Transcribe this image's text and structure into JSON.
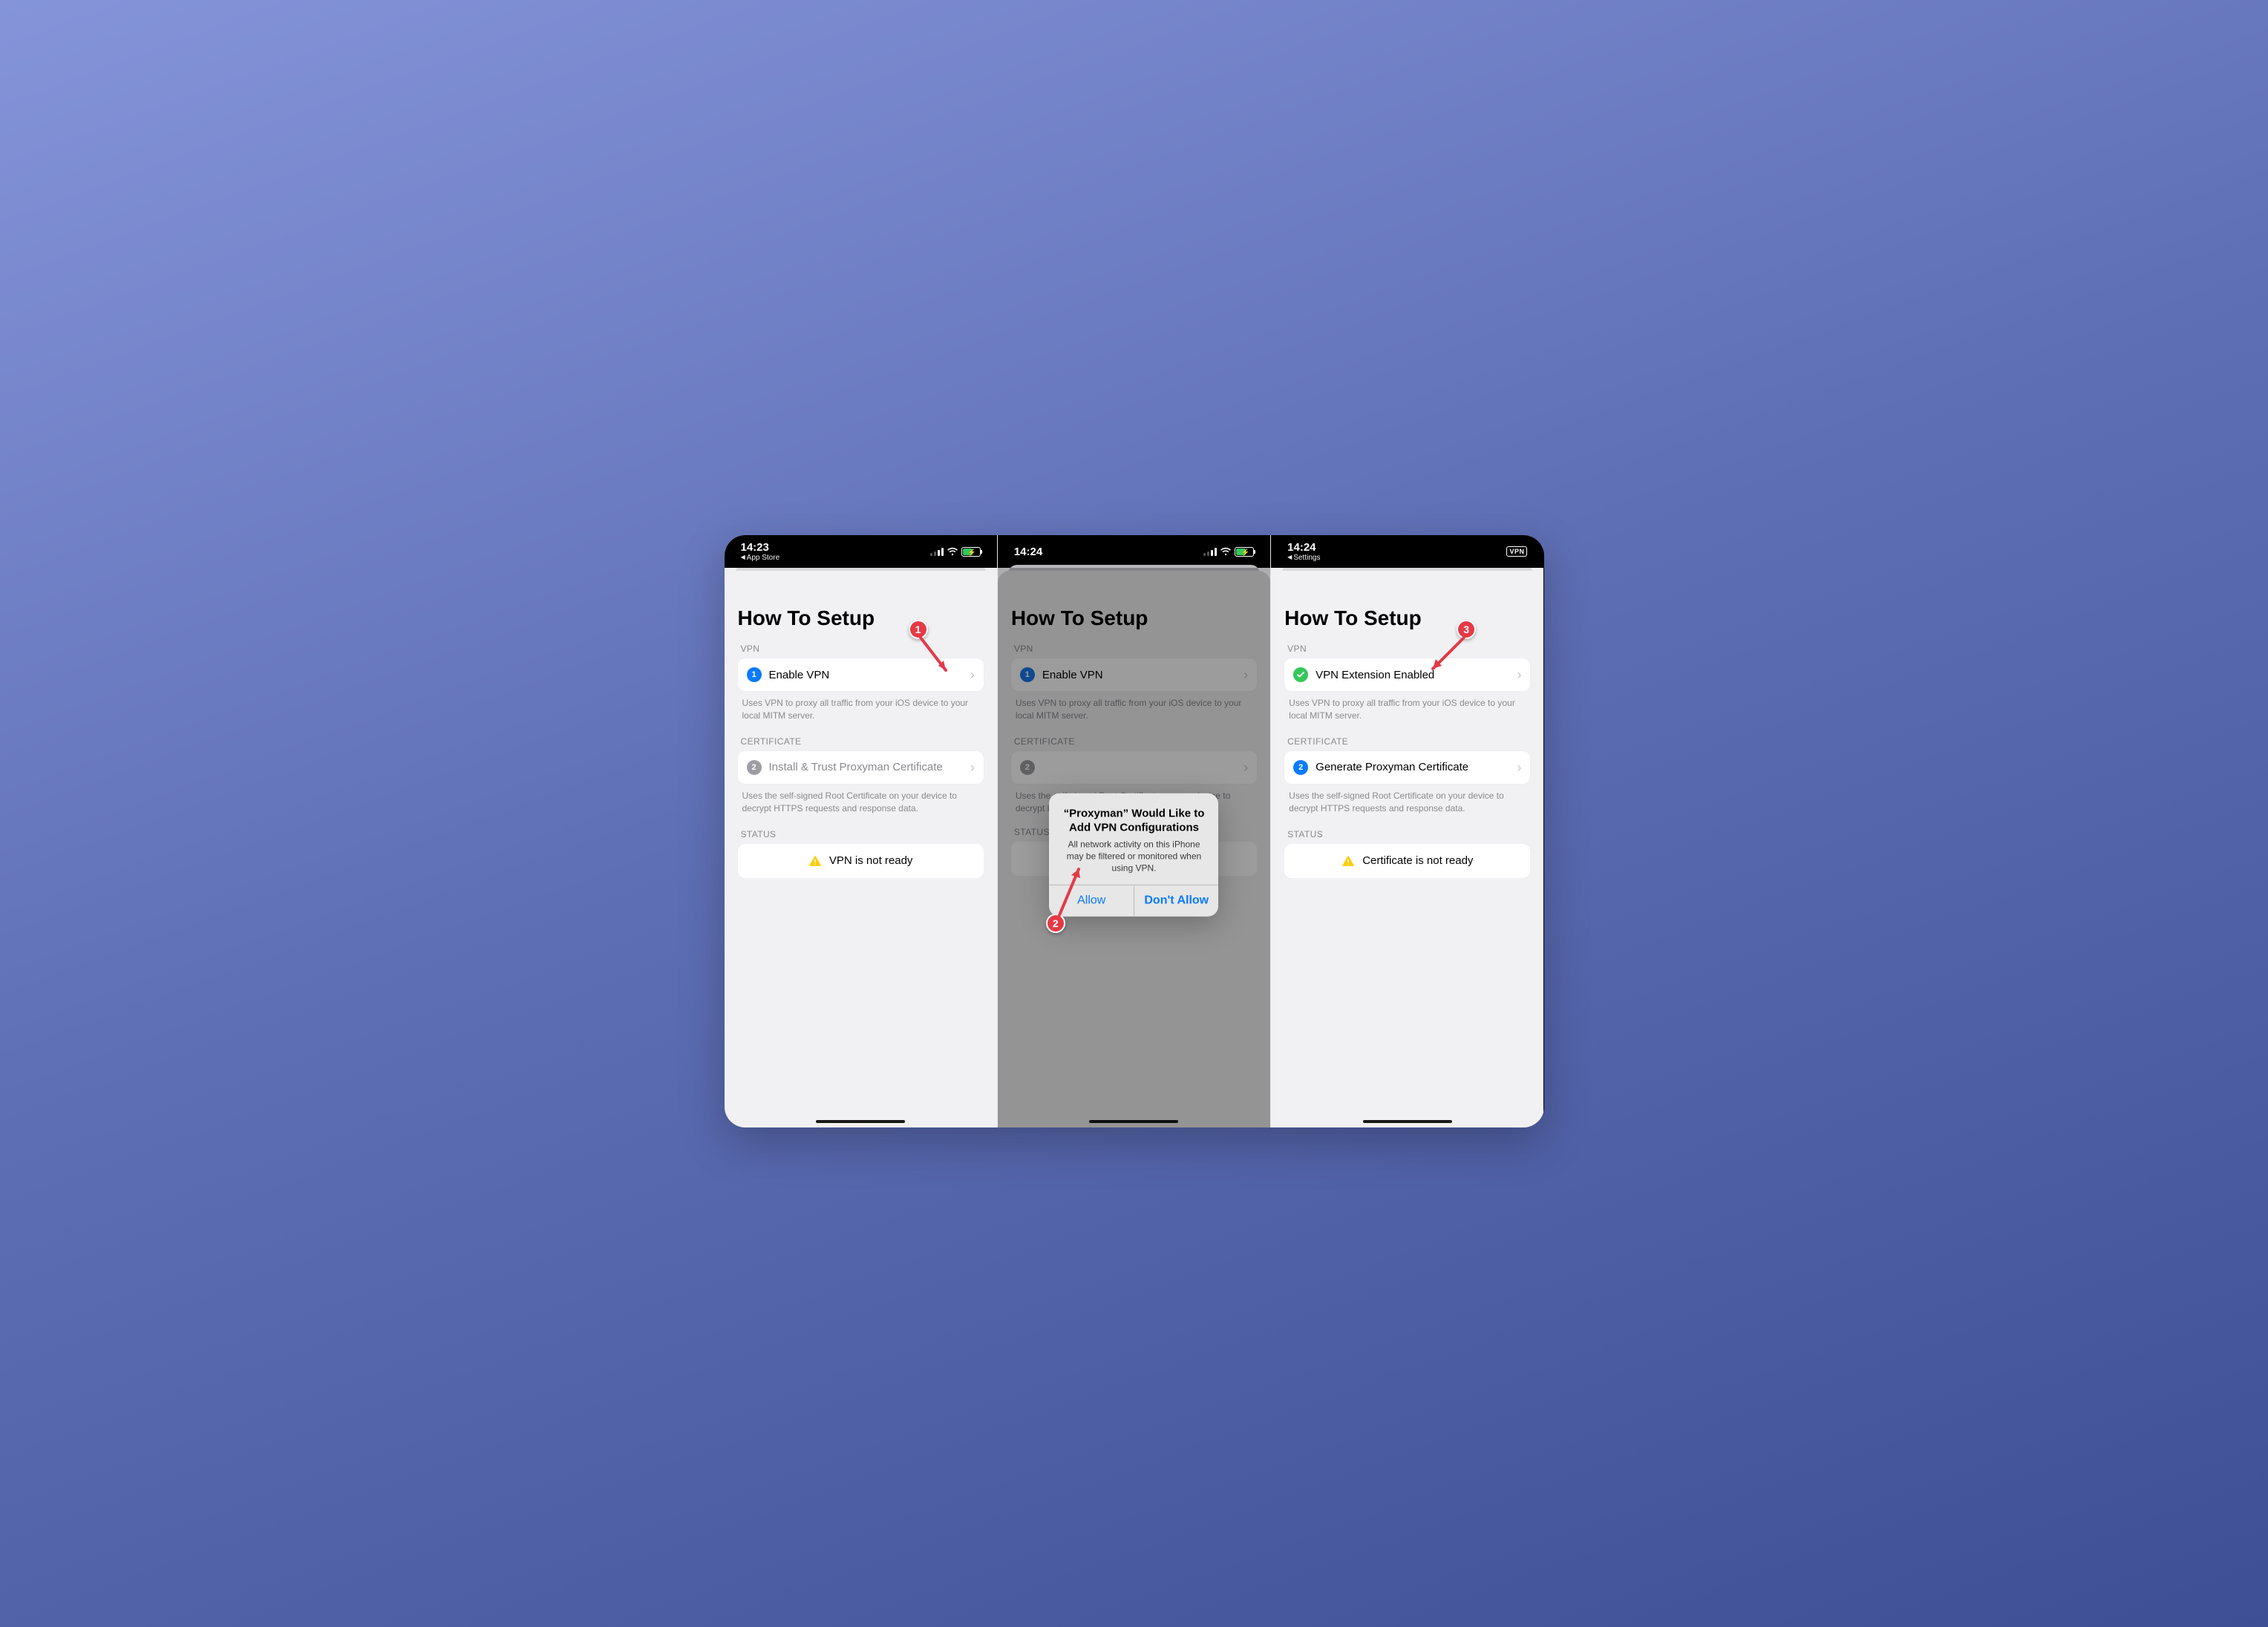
{
  "annotations": {
    "one": "1",
    "two": "2",
    "three": "3"
  },
  "phones": [
    {
      "time": "14:23",
      "back": "App Store",
      "show_vpn_badge": false,
      "title": "How To Setup",
      "vpn": {
        "label": "VPN",
        "row_text": "Enable VPN",
        "row_badge": "1",
        "row_badge_color": "blue",
        "footer": "Uses VPN to proxy all traffic from your iOS device to your local MITM server."
      },
      "cert": {
        "label": "CERTIFICATE",
        "row_text": "Install & Trust Proxyman Certificate",
        "row_badge": "2",
        "row_badge_color": "gray",
        "footer": "Uses the self-signed Root Certificate on your device to decrypt HTTPS requests and response data."
      },
      "status": {
        "label": "STATUS",
        "text": "VPN is not ready"
      }
    },
    {
      "time": "14:24",
      "back": "",
      "show_vpn_badge": false,
      "title": "How To Setup",
      "vpn": {
        "label": "VPN",
        "row_text": "Enable VPN",
        "row_badge": "1",
        "row_badge_color": "blue",
        "footer": "Uses VPN to proxy all traffic from your iOS device to your local MITM server."
      },
      "cert": {
        "label": "CERTIFICATE",
        "row_text": "",
        "row_badge": "2",
        "row_badge_color": "gray",
        "footer": "Uses the self-signed Root Certificate on your device to decrypt HTTPS requests and response data."
      },
      "status": {
        "label": "STATUS",
        "text": ""
      },
      "alert": {
        "title": "“Proxyman” Would Like to Add VPN Configurations",
        "message": "All network activity on this iPhone may be filtered or monitored when using VPN.",
        "allow": "Allow",
        "deny": "Don't Allow"
      }
    },
    {
      "time": "14:24",
      "back": "Settings",
      "show_vpn_badge": true,
      "vpn_badge_text": "VPN",
      "title": "How To Setup",
      "vpn": {
        "label": "VPN",
        "row_text": "VPN Extension Enabled",
        "row_badge": "check",
        "row_badge_color": "green",
        "footer": "Uses VPN to proxy all traffic from your iOS device to your local MITM server."
      },
      "cert": {
        "label": "CERTIFICATE",
        "row_text": "Generate Proxyman Certificate",
        "row_badge": "2",
        "row_badge_color": "blue",
        "footer": "Uses the self-signed Root Certificate on your device to decrypt HTTPS requests and response data."
      },
      "status": {
        "label": "STATUS",
        "text": "Certificate is not ready"
      }
    }
  ]
}
